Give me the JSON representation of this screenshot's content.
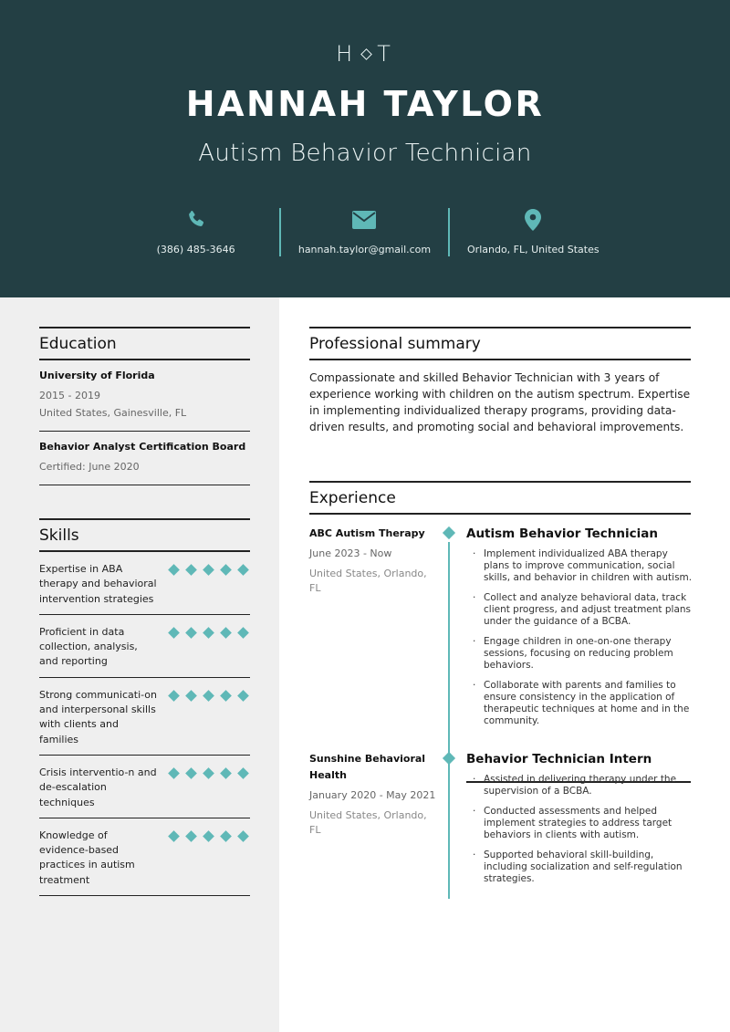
{
  "header": {
    "monogram_left": "H",
    "monogram_right": "T",
    "name": "HANNAH TAYLOR",
    "title": "Autism Behavior Technician",
    "accent_color": "#5fb8b7",
    "background_color": "#233f44",
    "contacts": [
      {
        "icon": "phone-icon",
        "text": "(386) 485-3646"
      },
      {
        "icon": "email-icon",
        "text": "hannah.taylor@gmail.com"
      },
      {
        "icon": "location-pin-icon",
        "text": "Orlando, FL, United States"
      }
    ]
  },
  "education": {
    "title": "Education",
    "items": [
      {
        "school": "University of Florida",
        "dates": "2015 - 2019",
        "location": "United States, Gainesville, FL"
      },
      {
        "school": "Behavior Analyst Certification Board",
        "dates": "Certified: June 2020"
      }
    ]
  },
  "skills": {
    "title": "Skills",
    "items": [
      {
        "label": "Expertise in ABA therapy and behavioral intervention strategies",
        "rating": 5,
        "max": 5
      },
      {
        "label": "Proficient in data collection, analysis, and reporting",
        "rating": 5,
        "max": 5
      },
      {
        "label": "Strong communicati-on and interpersonal skills with clients and families",
        "rating": 5,
        "max": 5
      },
      {
        "label": "Crisis interventio-n and de-escalation techniques",
        "rating": 5,
        "max": 5
      },
      {
        "label": "Knowledge of evidence-based practices in autism treatment",
        "rating": 5,
        "max": 5
      }
    ]
  },
  "summary": {
    "title": "Professional summary",
    "text": "Compassionate and skilled Behavior Technician with 3 years of experience working with children on the autism spectrum. Expertise in implementing individualized therapy programs, providing data-driven results, and promoting social and behavioral improvements."
  },
  "experience": {
    "title": "Experience",
    "jobs": [
      {
        "company": "ABC Autism Therapy",
        "dates": "June 2023 - Now",
        "location": "United States, Orlando, FL",
        "role": "Autism Behavior Technician",
        "bullets": [
          "Implement individualized ABA therapy plans to improve communication, social skills, and behavior in children with autism.",
          "Collect and analyze behavioral data, track client progress, and adjust treatment plans under the guidance of a BCBA.",
          "Engage children in one-on-one therapy sessions, focusing on reducing problem behaviors.",
          "Collaborate with parents and families to ensure consistency in the application of therapeutic techniques at home and in the community."
        ]
      },
      {
        "company": "Sunshine Behavioral Health",
        "dates": "January 2020 - May 2021",
        "location": "United States, Orlando, FL",
        "role": "Behavior Technician Intern",
        "bullets": [
          "Assisted in delivering therapy under the supervision of a BCBA.",
          "Conducted assessments and helped implement strategies to address target behaviors in clients with autism.",
          "Supported behavioral skill-building, including socialization and self-regulation strategies."
        ]
      }
    ]
  }
}
